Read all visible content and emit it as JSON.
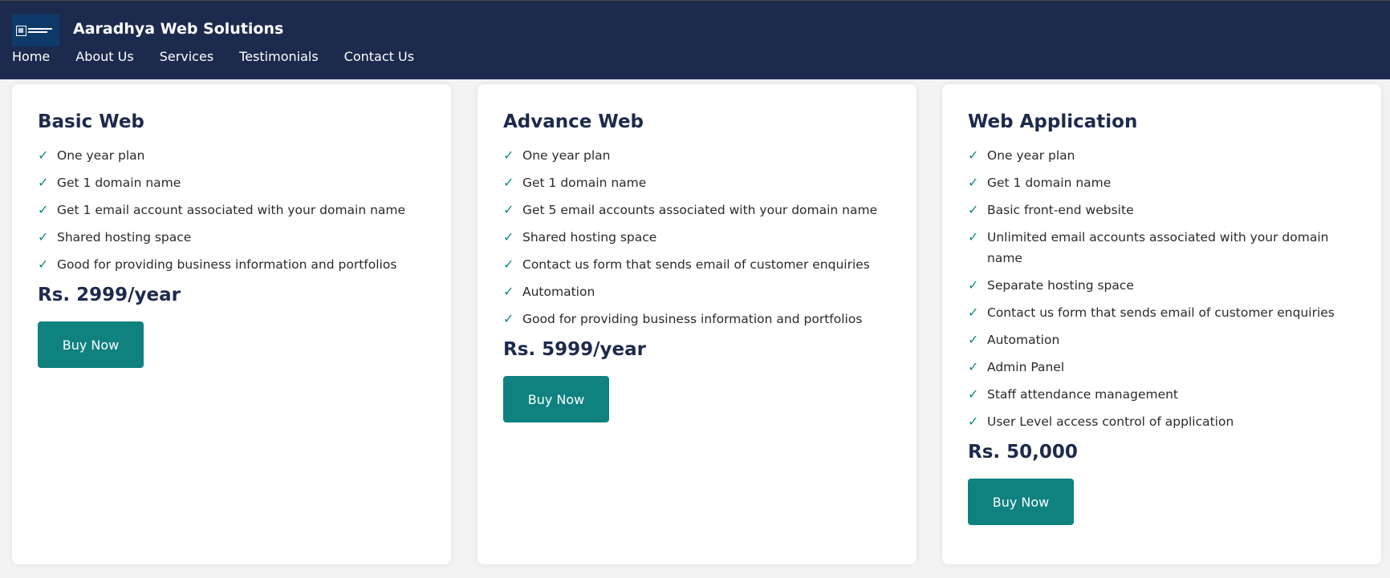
{
  "header": {
    "brand": "Aaradhya Web Solutions",
    "logo_alt": "Aaradhya Web Solutions logo",
    "nav": [
      "Home",
      "About Us",
      "Services",
      "Testimonials",
      "Contact Us"
    ]
  },
  "plans": [
    {
      "title": "Basic Web",
      "features": [
        "One year plan",
        "Get 1 domain name",
        "Get 1 email account associated with your domain name",
        "Shared hosting space",
        "Good for providing business information and portfolios"
      ],
      "price": "Rs. 2999/year",
      "button": "Buy Now"
    },
    {
      "title": "Advance Web",
      "features": [
        "One year plan",
        "Get 1 domain name",
        "Get 5 email accounts associated with your domain name",
        "Shared hosting space",
        "Contact us form that sends email of customer enquiries",
        "Automation",
        "Good for providing business information and portfolios"
      ],
      "price": "Rs. 5999/year",
      "button": "Buy Now"
    },
    {
      "title": "Web Application",
      "features": [
        "One year plan",
        "Get 1 domain name",
        "Basic front-end website",
        "Unlimited email accounts associated with your domain name",
        "Separate hosting space",
        "Contact us form that sends email of customer enquiries",
        "Automation",
        "Admin Panel",
        "Staff attendance management",
        "User Level access control of application"
      ],
      "price": "Rs. 50,000",
      "button": "Buy Now"
    }
  ],
  "check_glyph": "✓",
  "colors": {
    "header_bg": "#1c2a4d",
    "accent": "#0f817f",
    "page_bg": "#f3f3f3"
  }
}
